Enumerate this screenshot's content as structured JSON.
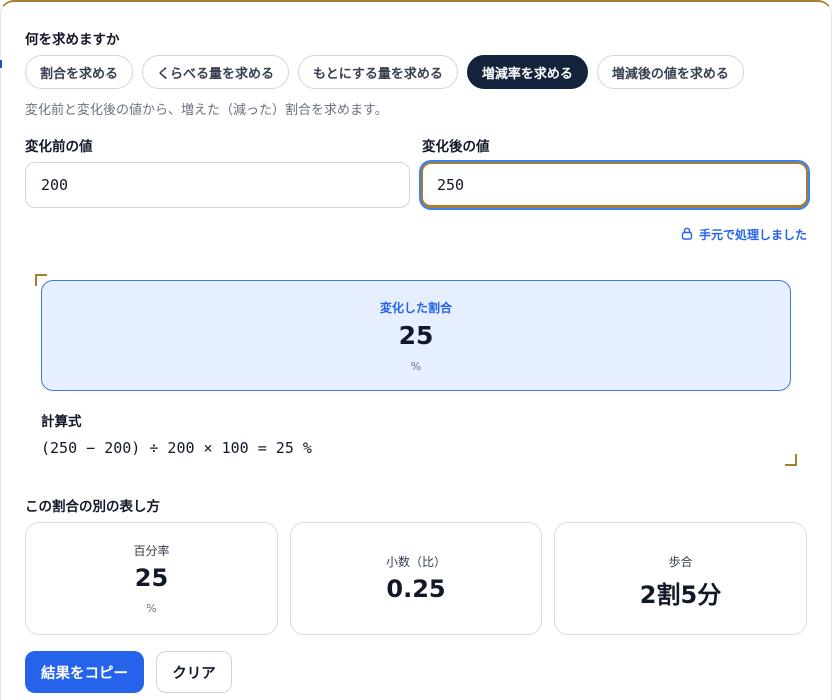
{
  "question": "何を求めますか",
  "modes": [
    {
      "label": "割合を求める",
      "active": false
    },
    {
      "label": "くらべる量を求める",
      "active": false
    },
    {
      "label": "もとにする量を求める",
      "active": false
    },
    {
      "label": "増減率を求める",
      "active": true
    },
    {
      "label": "増減後の値を求める",
      "active": false
    }
  ],
  "description": "変化前と変化後の値から、増えた（減った）割合を求めます。",
  "inputs": {
    "before": {
      "label": "変化前の値",
      "value": "200"
    },
    "after": {
      "label": "変化後の値",
      "value": "250"
    }
  },
  "local_note": {
    "text": "手元で処理しました",
    "icon": "lock-icon"
  },
  "result": {
    "title": "変化した割合",
    "value": "25",
    "unit": "%"
  },
  "formula": {
    "label": "計算式",
    "text": "(250 − 200) ÷ 200 × 100 = 25 %"
  },
  "alternatives": {
    "heading": "この割合の別の表し方",
    "cards": [
      {
        "title": "百分率",
        "value": "25",
        "unit": "%"
      },
      {
        "title": "小数（比）",
        "value": "0.25"
      },
      {
        "title": "歩合",
        "value": "2割5分"
      }
    ]
  },
  "actions": {
    "copy": "結果をコピー",
    "clear": "クリア"
  },
  "colors": {
    "accent": "#2563eb",
    "active_tab": "#13233b",
    "result_bg": "#e6efff",
    "gold": "#a87d2e"
  }
}
